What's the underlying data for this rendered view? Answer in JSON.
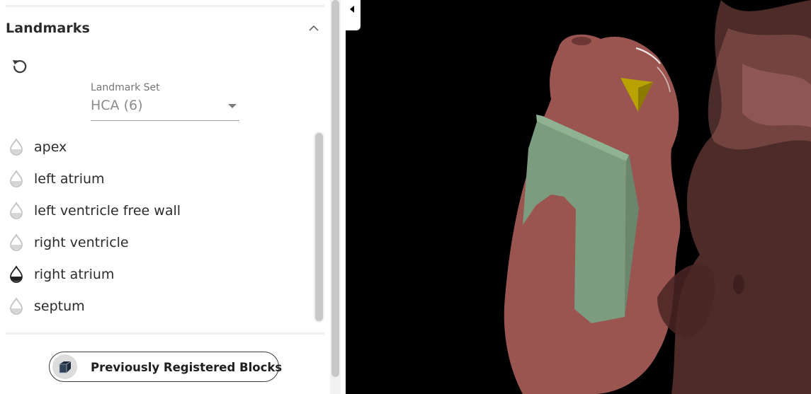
{
  "landmarks_panel": {
    "title": "Landmarks",
    "collapse_icon": "chevron-up-icon",
    "reset_icon": "reset-icon",
    "landmark_set": {
      "label": "Landmark Set",
      "value": "HCA (6)"
    },
    "items": [
      {
        "label": "apex",
        "status": "unplaced"
      },
      {
        "label": "left atrium",
        "status": "unplaced"
      },
      {
        "label": "left ventricle free wall",
        "status": "unplaced"
      },
      {
        "label": "right ventricle",
        "status": "unplaced"
      },
      {
        "label": "right atrium",
        "status": "placed"
      },
      {
        "label": "septum",
        "status": "unplaced"
      }
    ],
    "blocks_button": {
      "label": "Previously Registered Blocks",
      "icon": "cube-icon"
    }
  },
  "viewport": {
    "toggle_icon": "chevron-left-icon",
    "colors": {
      "background": "#000000",
      "organ": "#9a5551",
      "block": "#7c9c7f",
      "marker": "#b8a200"
    }
  }
}
